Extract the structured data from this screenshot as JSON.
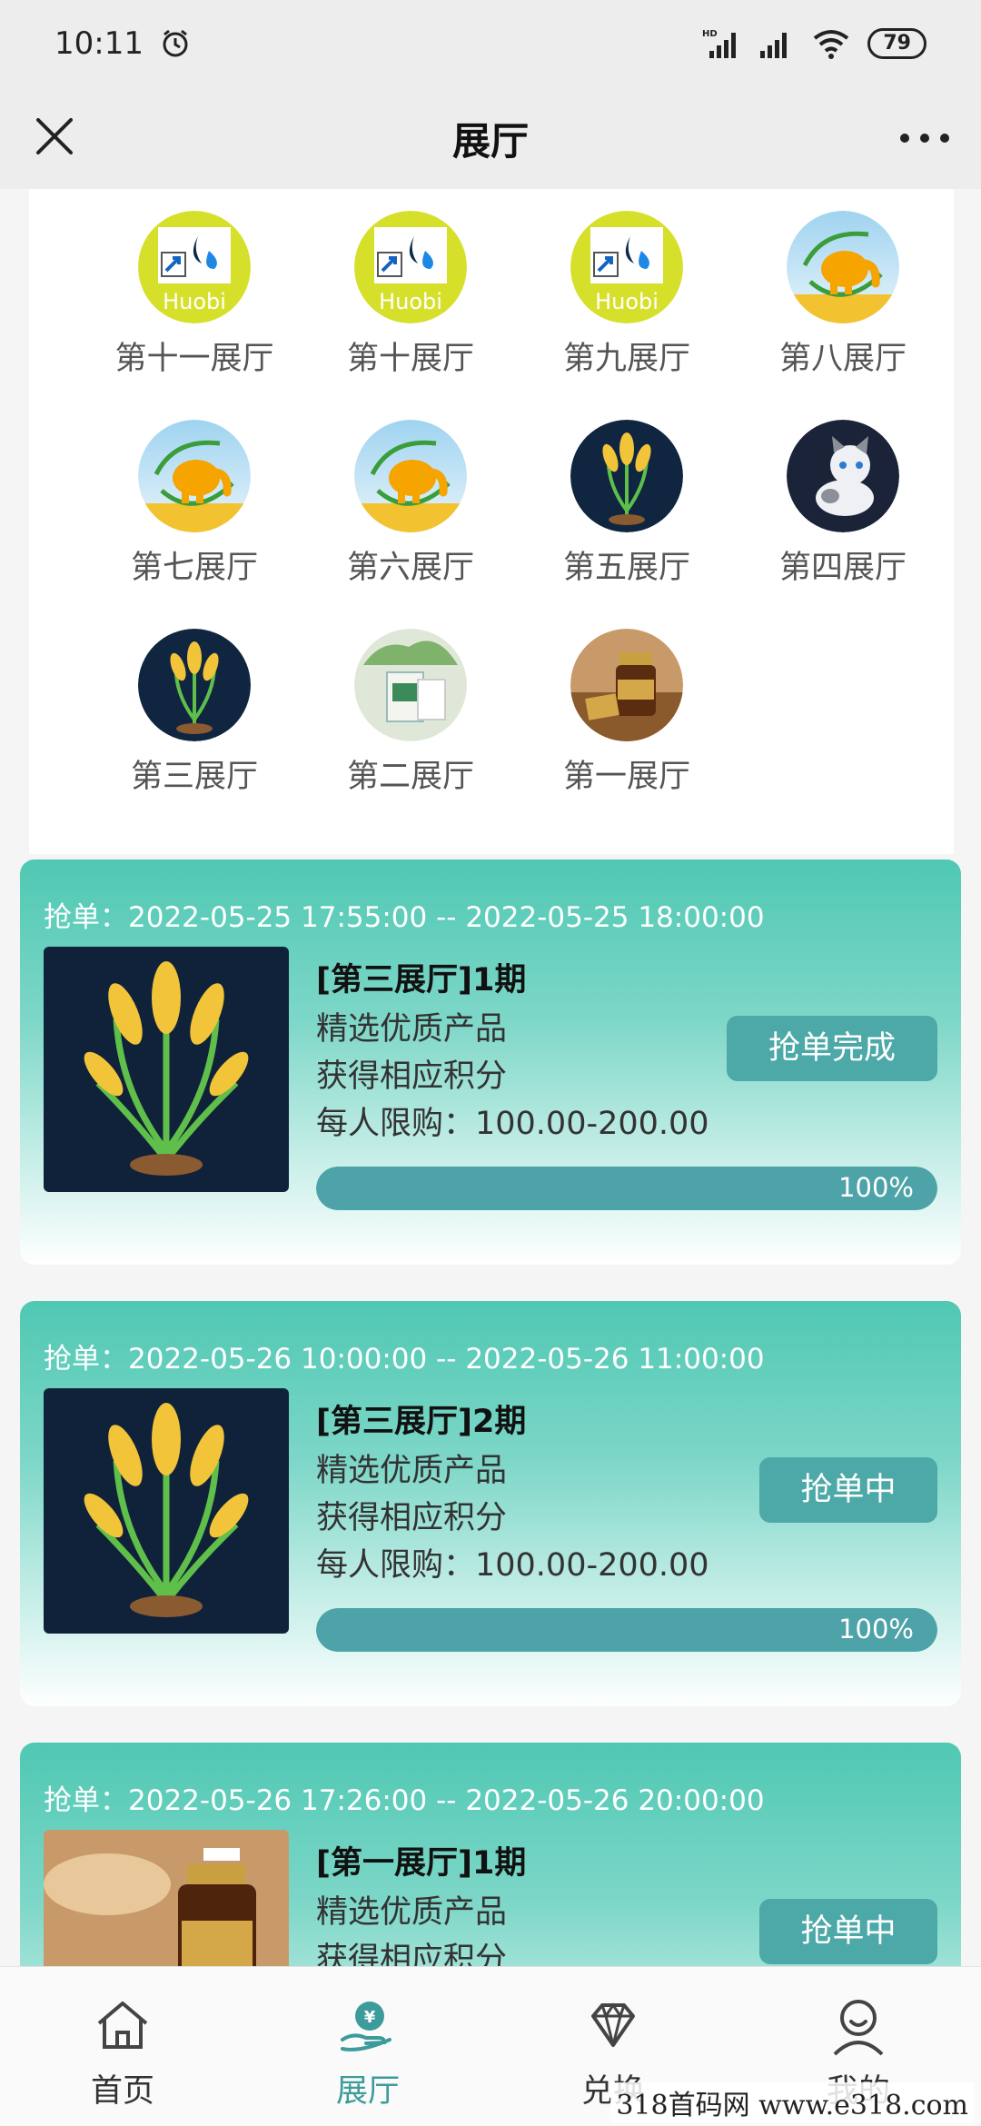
{
  "status_bar": {
    "time": "10:11",
    "battery": "79",
    "icons": [
      "alarm-icon",
      "hd-signal-icon",
      "signal-icon",
      "wifi-icon",
      "battery-icon"
    ]
  },
  "nav": {
    "title": "展厅",
    "close_icon": "close-icon",
    "more_icon": "more-icon"
  },
  "halls": [
    {
      "label": "第十一展厅",
      "avatar": "huobi"
    },
    {
      "label": "第十展厅",
      "avatar": "huobi"
    },
    {
      "label": "第九展厅",
      "avatar": "huobi"
    },
    {
      "label": "第八展厅",
      "avatar": "elephant"
    },
    {
      "label": "第七展厅",
      "avatar": "elephant"
    },
    {
      "label": "第六展厅",
      "avatar": "elephant"
    },
    {
      "label": "第五展厅",
      "avatar": "wheat"
    },
    {
      "label": "第四展厅",
      "avatar": "cat"
    },
    {
      "label": "第三展厅",
      "avatar": "wheat"
    },
    {
      "label": "第二展厅",
      "avatar": "patch"
    },
    {
      "label": "第一展厅",
      "avatar": "jar"
    }
  ],
  "hall_avatar_text": "Huobi",
  "cards": [
    {
      "time": "抢单：2022-05-25 17:55:00 -- 2022-05-25 18:00:00",
      "title": "[第三展厅]1期",
      "line1": "精选优质产品",
      "line2": "获得相应积分",
      "line3": "每人限购：100.00-200.00",
      "button": "抢单完成",
      "progress_text": "100%",
      "progress": 1.0,
      "image": "wheat"
    },
    {
      "time": "抢单：2022-05-26 10:00:00 -- 2022-05-26 11:00:00",
      "title": "[第三展厅]2期",
      "line1": "精选优质产品",
      "line2": "获得相应积分",
      "line3": "每人限购：100.00-200.00",
      "button": "抢单中",
      "progress_text": "100%",
      "progress": 1.0,
      "image": "wheat"
    },
    {
      "time": "抢单：2022-05-26 17:26:00 -- 2022-05-26 20:00:00",
      "title": "[第一展厅]1期",
      "line1": "精选优质产品",
      "line2": "获得相应积分",
      "button": "抢单中",
      "image": "jar"
    }
  ],
  "tabs": [
    {
      "label": "首页",
      "icon": "home-icon",
      "active": false
    },
    {
      "label": "展厅",
      "icon": "hall-icon",
      "active": true
    },
    {
      "label": "兑换",
      "icon": "diamond-icon",
      "active": false
    },
    {
      "label": "我的",
      "icon": "user-icon",
      "active": false
    }
  ],
  "watermark": "318首码网 www.e318.com",
  "colors": {
    "accent": "#3e9b9b",
    "card_top": "#4fc8b3",
    "button": "#4da8a8",
    "progress": "#4da3a8",
    "nav_bg": "#ededed"
  }
}
